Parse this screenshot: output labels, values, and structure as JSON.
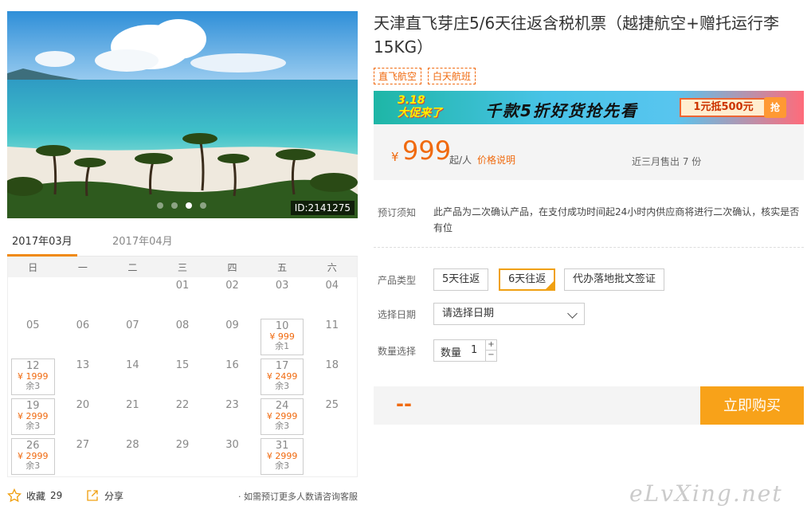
{
  "photo": {
    "id_label": "ID:2141275"
  },
  "months": [
    "2017年03月",
    "2017年04月"
  ],
  "weekdays": [
    "日",
    "一",
    "二",
    "三",
    "四",
    "五",
    "六"
  ],
  "calendar": {
    "days": [
      {
        "d": "",
        "p": "",
        "r": ""
      },
      {
        "d": "",
        "p": "",
        "r": ""
      },
      {
        "d": "",
        "p": "",
        "r": ""
      },
      {
        "d": "01",
        "p": "",
        "r": ""
      },
      {
        "d": "02",
        "p": "",
        "r": ""
      },
      {
        "d": "03",
        "p": "",
        "r": ""
      },
      {
        "d": "04",
        "p": "",
        "r": ""
      },
      {
        "d": "05",
        "p": "",
        "r": ""
      },
      {
        "d": "06",
        "p": "",
        "r": ""
      },
      {
        "d": "07",
        "p": "",
        "r": ""
      },
      {
        "d": "08",
        "p": "",
        "r": ""
      },
      {
        "d": "09",
        "p": "",
        "r": ""
      },
      {
        "d": "10",
        "p": "¥ 999",
        "r": "余1"
      },
      {
        "d": "11",
        "p": "",
        "r": ""
      },
      {
        "d": "12",
        "p": "¥ 1999",
        "r": "余3"
      },
      {
        "d": "13",
        "p": "",
        "r": ""
      },
      {
        "d": "14",
        "p": "",
        "r": ""
      },
      {
        "d": "15",
        "p": "",
        "r": ""
      },
      {
        "d": "16",
        "p": "",
        "r": ""
      },
      {
        "d": "17",
        "p": "¥ 2499",
        "r": "余3"
      },
      {
        "d": "18",
        "p": "",
        "r": ""
      },
      {
        "d": "19",
        "p": "¥ 2999",
        "r": "余3"
      },
      {
        "d": "20",
        "p": "",
        "r": ""
      },
      {
        "d": "21",
        "p": "",
        "r": ""
      },
      {
        "d": "22",
        "p": "",
        "r": ""
      },
      {
        "d": "23",
        "p": "",
        "r": ""
      },
      {
        "d": "24",
        "p": "¥ 2999",
        "r": "余3"
      },
      {
        "d": "25",
        "p": "",
        "r": ""
      },
      {
        "d": "26",
        "p": "¥ 2999",
        "r": "余3"
      },
      {
        "d": "27",
        "p": "",
        "r": ""
      },
      {
        "d": "28",
        "p": "",
        "r": ""
      },
      {
        "d": "29",
        "p": "",
        "r": ""
      },
      {
        "d": "30",
        "p": "",
        "r": ""
      },
      {
        "d": "31",
        "p": "¥ 2999",
        "r": "余3"
      },
      {
        "d": "",
        "p": "",
        "r": ""
      }
    ]
  },
  "actions": {
    "favorite_label": "收藏",
    "favorite_count": "29",
    "share_label": "分享",
    "consult_text": "· 如需预订更多人数请咨询客服"
  },
  "product": {
    "title": "天津直飞芽庄5/6天往返含税机票（越捷航空+赠托运行李15KG）",
    "tags": [
      "直飞航空",
      "白天航班"
    ]
  },
  "banner": {
    "promo_date": "3.18",
    "promo_line": "大促来了",
    "headline": "千款5折好货抢先看",
    "coupon": "1元抵500元",
    "grab": "抢"
  },
  "price": {
    "currency": "¥",
    "amount": "999",
    "unit": "起/人",
    "explain_link": "价格说明",
    "sold_text": "近三月售出 7 份"
  },
  "notice": {
    "label": "预订须知",
    "text": "此产品为二次确认产品，在支付成功时间起24小时内供应商将进行二次确认，核实是否有位"
  },
  "options": {
    "type_label": "产品类型",
    "types": [
      "5天往返",
      "6天往返",
      "代办落地批文签证"
    ],
    "date_label": "选择日期",
    "date_placeholder": "请选择日期",
    "qty_label": "数量选择",
    "qty_inner_label": "数量",
    "qty_value": "1",
    "plus": "+",
    "minus": "−"
  },
  "buy": {
    "total": "--",
    "button": "立即购买"
  },
  "watermark": "eLvXing.net"
}
